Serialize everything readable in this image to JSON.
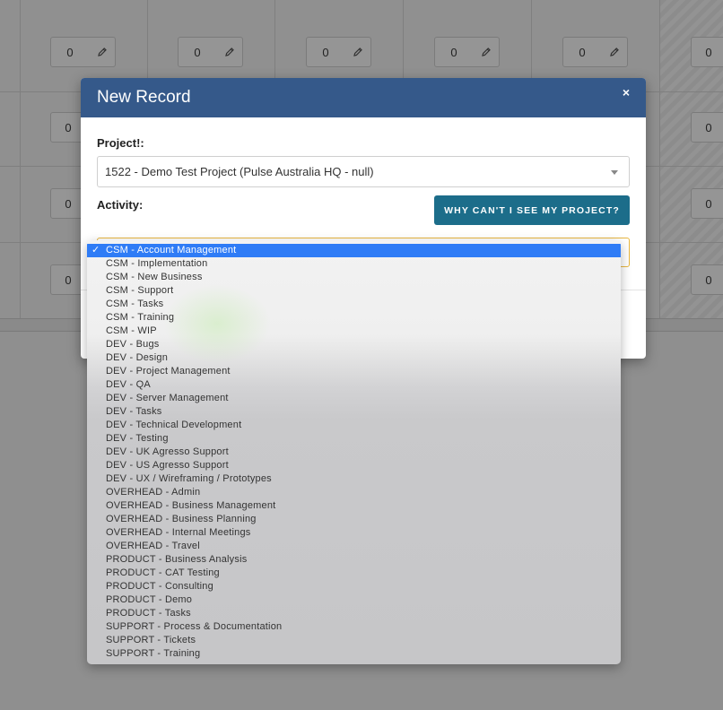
{
  "background": {
    "cell_value": "0",
    "columns": 6
  },
  "modal": {
    "title": "New Record",
    "close_label": "×",
    "project_label": "Project!:",
    "project_value": "1522 - Demo Test Project (Pulse Australia HQ - null)",
    "activity_label": "Activity:",
    "why_button_label": "WHY CAN'T I SEE MY PROJECT?"
  },
  "colors": {
    "header": "#35598a",
    "button": "#1c6d8a",
    "selected_option": "#2f7cf6",
    "focus_border": "#e8b640"
  },
  "activity_options": [
    "CSM - Account Management",
    "CSM - Implementation",
    "CSM - New Business",
    "CSM - Support",
    "CSM - Tasks",
    "CSM - Training",
    "CSM - WIP",
    "DEV - Bugs",
    "DEV - Design",
    "DEV - Project Management",
    "DEV - QA",
    "DEV - Server Management",
    "DEV - Tasks",
    "DEV - Technical Development",
    "DEV - Testing",
    "DEV - UK Agresso Support",
    "DEV - US Agresso Support",
    "DEV - UX / Wireframing / Prototypes",
    "OVERHEAD - Admin",
    "OVERHEAD - Business Management",
    "OVERHEAD - Business Planning",
    "OVERHEAD - Internal Meetings",
    "OVERHEAD - Travel",
    "PRODUCT - Business Analysis",
    "PRODUCT - CAT Testing",
    "PRODUCT - Consulting",
    "PRODUCT - Demo",
    "PRODUCT - Tasks",
    "SUPPORT - Process & Documentation",
    "SUPPORT - Tickets",
    "SUPPORT - Training"
  ],
  "selected_index": 0
}
